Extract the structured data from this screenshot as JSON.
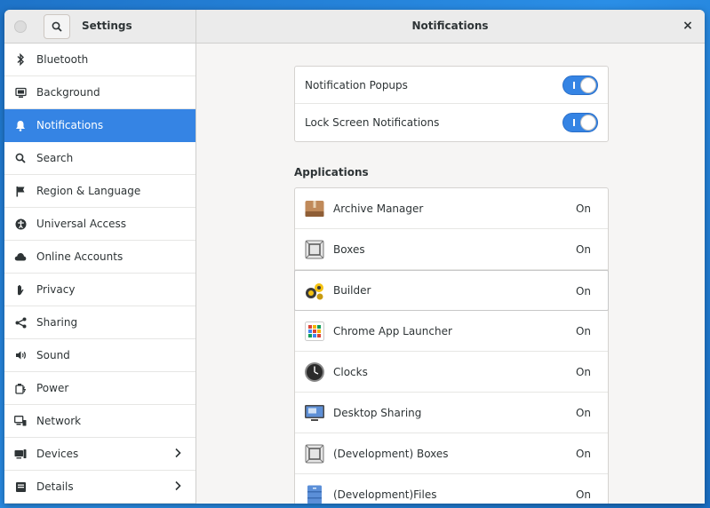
{
  "window": {
    "sidebar_title": "Settings",
    "page_title": "Notifications",
    "close_glyph": "×"
  },
  "sidebar": {
    "items": [
      {
        "label": "Bluetooth",
        "icon": "bluetooth-icon"
      },
      {
        "label": "Background",
        "icon": "background-icon"
      },
      {
        "label": "Notifications",
        "icon": "bell-icon",
        "active": true
      },
      {
        "label": "Search",
        "icon": "search-icon"
      },
      {
        "label": "Region & Language",
        "icon": "flag-icon"
      },
      {
        "label": "Universal Access",
        "icon": "accessibility-icon"
      },
      {
        "label": "Online Accounts",
        "icon": "cloud-icon"
      },
      {
        "label": "Privacy",
        "icon": "hand-icon"
      },
      {
        "label": "Sharing",
        "icon": "share-icon"
      },
      {
        "label": "Sound",
        "icon": "speaker-icon"
      },
      {
        "label": "Power",
        "icon": "power-icon"
      },
      {
        "label": "Network",
        "icon": "network-icon"
      },
      {
        "label": "Devices",
        "icon": "devices-icon",
        "chevron": true
      },
      {
        "label": "Details",
        "icon": "details-icon",
        "chevron": true
      }
    ]
  },
  "toggles": [
    {
      "label": "Notification Popups",
      "on": true
    },
    {
      "label": "Lock Screen Notifications",
      "on": true
    }
  ],
  "applications": {
    "title": "Applications",
    "items": [
      {
        "name": "Archive Manager",
        "status": "On",
        "icon": "archive-icon"
      },
      {
        "name": "Boxes",
        "status": "On",
        "icon": "boxes-icon"
      },
      {
        "name": "Builder",
        "status": "On",
        "icon": "builder-icon"
      },
      {
        "name": "Chrome App Launcher",
        "status": "On",
        "icon": "chrome-launcher-icon"
      },
      {
        "name": "Clocks",
        "status": "On",
        "icon": "clock-icon"
      },
      {
        "name": "Desktop Sharing",
        "status": "On",
        "icon": "desktop-sharing-icon"
      },
      {
        "name": "(Development) Boxes",
        "status": "On",
        "icon": "boxes-icon"
      },
      {
        "name": "(Development)Files",
        "status": "On",
        "icon": "files-icon"
      }
    ]
  },
  "colors": {
    "accent": "#3584e4",
    "desktop": "#1e73c8"
  }
}
